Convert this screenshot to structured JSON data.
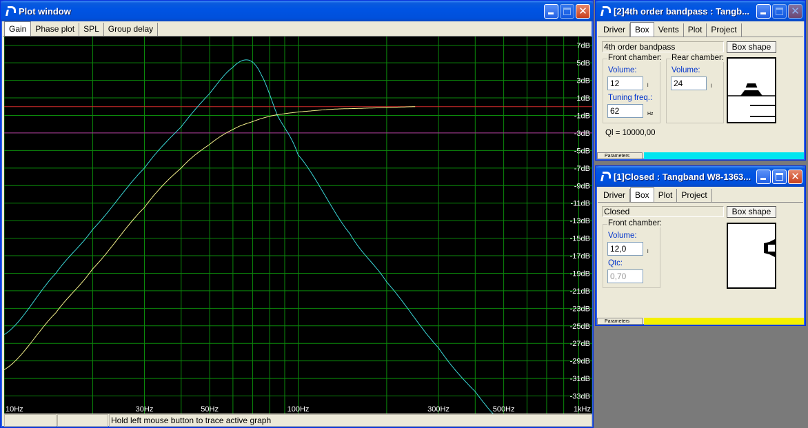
{
  "plot_window": {
    "title": "Plot window",
    "tabs": [
      "Gain",
      "Phase plot",
      "SPL",
      "Group delay"
    ],
    "status_left": "",
    "status_mid": "",
    "status_text": "Hold left mouse button to trace active graph"
  },
  "colors": {
    "grid": "#0b8a0b",
    "bg": "#000000",
    "cyan": "#3ad6d6",
    "yellow": "#f2ef8a",
    "red": "#d12a2a",
    "magenta": "#b32aa0"
  },
  "chart_data": {
    "type": "line",
    "xscale": "log",
    "xlim": [
      10,
      1000
    ],
    "ylim": [
      -35,
      8
    ],
    "x_ticks": [
      "10Hz",
      "30Hz",
      "50Hz",
      "100Hz",
      "300Hz",
      "500Hz",
      "1kHz"
    ],
    "y_ticks": [
      "7dB",
      "5dB",
      "3dB",
      "1dB",
      "-1dB",
      "-3dB",
      "-5dB",
      "-7dB",
      "-9dB",
      "-11dB",
      "-13dB",
      "-15dB",
      "-17dB",
      "-19dB",
      "-21dB",
      "-23dB",
      "-25dB",
      "-27dB",
      "-29dB",
      "-31dB",
      "-33dB"
    ],
    "reference_lines": [
      0,
      -3
    ],
    "series": [
      {
        "color": "cyan",
        "x": [
          10,
          15,
          20,
          30,
          40,
          50,
          60,
          68,
          75,
          85,
          100,
          150,
          200,
          300,
          400,
          500
        ],
        "y": [
          -26,
          -19,
          -14,
          -7,
          -2.3,
          1.5,
          4.5,
          5.3,
          3.6,
          -1,
          -5.5,
          -14.5,
          -20,
          -27.5,
          -32.5,
          -36
        ]
      },
      {
        "color": "yellow",
        "x": [
          10,
          15,
          20,
          30,
          40,
          50,
          60,
          70,
          80,
          90,
          100,
          130,
          160,
          200,
          250
        ],
        "y": [
          -30,
          -23.5,
          -18.5,
          -11.5,
          -7,
          -4.3,
          -2.6,
          -1.7,
          -1.1,
          -0.8,
          -0.6,
          -0.3,
          -0.2,
          -0.1,
          0
        ]
      }
    ]
  },
  "bandpass_window": {
    "title": "[2]4th order bandpass : Tangb...",
    "tabs": [
      "Driver",
      "Box",
      "Vents",
      "Plot",
      "Project"
    ],
    "box_type": "4th order bandpass",
    "box_shape_button": "Box shape",
    "front_chamber_label": "Front chamber:",
    "rear_chamber_label": "Rear chamber:",
    "front_volume_label": "Volume:",
    "front_volume": "12",
    "front_volume_unit": "l",
    "tuning_label": "Tuning freq.:",
    "tuning_value": "62",
    "tuning_unit": "Hz",
    "rear_volume_label": "Volume:",
    "rear_volume": "24",
    "rear_volume_unit": "l",
    "ql": "Ql = 10000,00",
    "status_label": "Parameters",
    "status_color": "#00e5f0"
  },
  "closed_window": {
    "title": "[1]Closed : Tangband W8-1363...",
    "tabs": [
      "Driver",
      "Box",
      "Plot",
      "Project"
    ],
    "box_type": "Closed",
    "box_shape_button": "Box shape",
    "front_chamber_label": "Front chamber:",
    "volume_label": "Volume:",
    "volume": "12,0",
    "volume_unit": "l",
    "qtc_label": "Qtc:",
    "qtc": "0,70",
    "status_label": "Parameters",
    "status_color": "#f5f000"
  }
}
